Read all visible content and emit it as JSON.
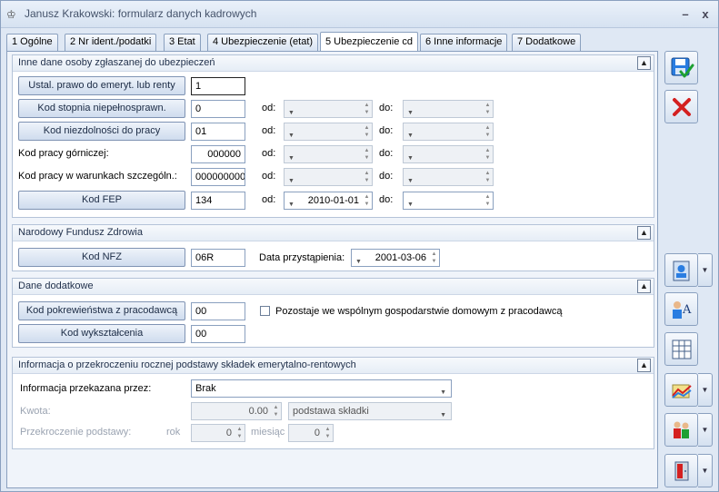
{
  "window": {
    "title": "Janusz Krakowski: formularz danych kadrowych",
    "minimize": "–",
    "close": "x"
  },
  "tabs": [
    {
      "label": "1 Ogólne"
    },
    {
      "label": "2 Nr ident./podatki"
    },
    {
      "label": "3 Etat"
    },
    {
      "label": "4 Ubezpieczenie (etat)"
    },
    {
      "label": "5 Ubezpieczenie cd"
    },
    {
      "label": "6 Inne informacje"
    },
    {
      "label": "7 Dodatkowe"
    }
  ],
  "section1": {
    "title": "Inne dane osoby zgłaszanej do ubezpieczeń",
    "btn_emeryt": "Ustal. prawo do emeryt. lub renty",
    "emeryt_value": "1",
    "btn_niepelnospr": "Kod stopnia niepełnosprawn.",
    "niepelnospr_value": "0",
    "btn_niezdolnosci": "Kod niezdolności do pracy",
    "niezdolnosci_value": "01",
    "lbl_gorniczej": "Kod pracy górniczej:",
    "gorniczej_value": "000000",
    "lbl_warunkach": "Kod pracy w warunkach szczególn.:",
    "warunkach_value": "000000000",
    "btn_fep": "Kod FEP",
    "fep_value": "134",
    "lbl_od": "od:",
    "lbl_do": "do:",
    "fep_od": "2010-01-01"
  },
  "section2": {
    "title": "Narodowy Fundusz Zdrowia",
    "btn_nfz": "Kod NFZ",
    "nfz_value": "06R",
    "lbl_data": "Data przystąpienia:",
    "data_value": "2001-03-06"
  },
  "section3": {
    "title": "Dane dodatkowe",
    "btn_pokrew": "Kod pokrewieństwa z pracodawcą",
    "pokrew_value": "00",
    "checkbox_label": "Pozostaje we wspólnym gospodarstwie domowym z pracodawcą",
    "btn_wykszt": "Kod wykształcenia",
    "wykszt_value": "00"
  },
  "section4": {
    "title": "Informacja o przekroczeniu rocznej podstawy składek emerytalno-rentowych",
    "lbl_info": "Informacja przekazana przez:",
    "info_value": "Brak",
    "lbl_kwota": "Kwota:",
    "kwota_value": "0.00",
    "podstawa_value": "podstawa składki",
    "lbl_przekroczenie": "Przekroczenie podstawy:",
    "lbl_rok": "rok",
    "rok_value": "0",
    "lbl_miesiac": "miesiąc",
    "miesiac_value": "0"
  },
  "colors": {
    "save_accent": "#2a7de1",
    "cancel_accent": "#d42020",
    "check_accent": "#1ea032"
  }
}
